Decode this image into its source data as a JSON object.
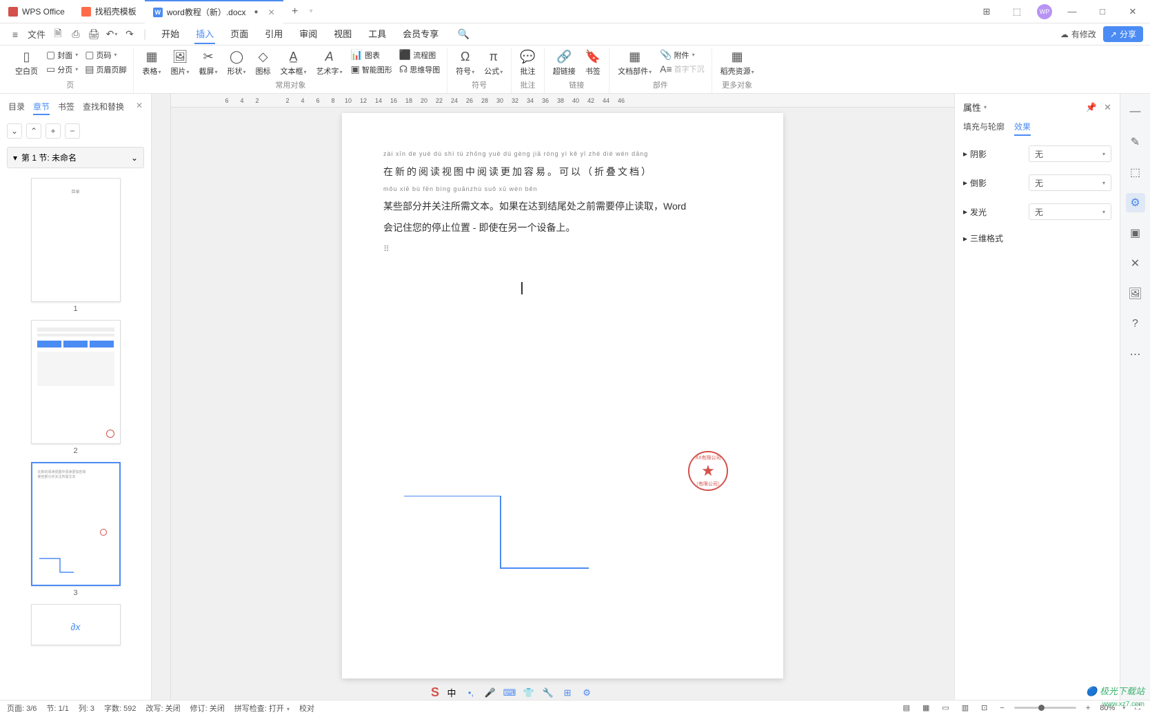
{
  "titlebar": {
    "app": "WPS Office",
    "tab_template": "找稻壳模板",
    "doc_name": "word教程（新）.docx"
  },
  "menubar": {
    "file": "文件",
    "items": [
      "开始",
      "插入",
      "页面",
      "引用",
      "审阅",
      "视图",
      "工具",
      "会员专享"
    ],
    "active_index": 1,
    "modified": "有修改",
    "share": "分享"
  },
  "ribbon": {
    "blank_page": "空白页",
    "cover": "封面",
    "page_num": "页码",
    "page_break": "分页",
    "header_footer": "页眉页脚",
    "g_page": "页",
    "table": "表格",
    "picture": "图片",
    "screenshot": "截屏",
    "shapes": "形状",
    "icon": "图标",
    "textbox": "文本框",
    "wordart": "艺术字",
    "chart": "图表",
    "flowchart": "流程图",
    "smartart": "智能图形",
    "mindmap": "思维导图",
    "g_common": "常用对象",
    "symbol": "符号",
    "equation": "公式",
    "g_symbol": "符号",
    "comment": "批注",
    "g_comment": "批注",
    "hyperlink": "超链接",
    "bookmark": "书签",
    "g_link": "链接",
    "docparts": "文档部件",
    "attachment": "附件",
    "dropcap": "首字下沉",
    "g_parts": "部件",
    "resources": "稻壳资源",
    "g_more": "更多对象"
  },
  "navpane": {
    "tabs": [
      "目录",
      "章节",
      "书签",
      "查找和替换"
    ],
    "active_index": 1,
    "section": "第 1 节: 未命名",
    "thumb_labels": [
      "1",
      "2",
      "3"
    ],
    "active_thumb": 2
  },
  "ruler_top": [
    "6",
    "4",
    "2",
    "",
    "2",
    "4",
    "6",
    "8",
    "10",
    "12",
    "14",
    "16",
    "18",
    "20",
    "22",
    "24",
    "26",
    "28",
    "30",
    "32",
    "34",
    "36",
    "38",
    "40",
    "42",
    "44",
    "46"
  ],
  "doc": {
    "pinyin1": "zài  xīn  de  yuè  dú  shì  tú  zhōng  yuè  dú  gèng  jiā  róng  yì        kě  yǐ        zhé  dié  wén  dāng",
    "line1": "在新的阅读视图中阅读更加容易。可以（折叠文档）",
    "pinyin2": "mǒu xiē  bù fēn bìng guānzhù suǒ xū wén běn",
    "line2": "某些部分并关注所需文本。如果在达到结尾处之前需要停止读取，Word",
    "line3": "会记住您的停止位置 - 即使在另一个设备上。"
  },
  "properties": {
    "title": "属性",
    "tab_fill": "填充与轮廓",
    "tab_effect": "效果",
    "shadow": "阴影",
    "bevel": "倒影",
    "glow": "发光",
    "threed": "三维格式",
    "none": "无"
  },
  "statusbar": {
    "page": "页面: 3/6",
    "section": "节: 1/1",
    "column": "列: 3",
    "words": "字数: 592",
    "track_off": "改写: 关闭",
    "revision": "修订: 关闭",
    "spell": "拼写检查: 打开",
    "proof": "校对",
    "zoom": "80%"
  },
  "ime": {
    "zhong": "中"
  },
  "watermark": {
    "main": "极光下载站",
    "sub": "www.xz7.com"
  }
}
